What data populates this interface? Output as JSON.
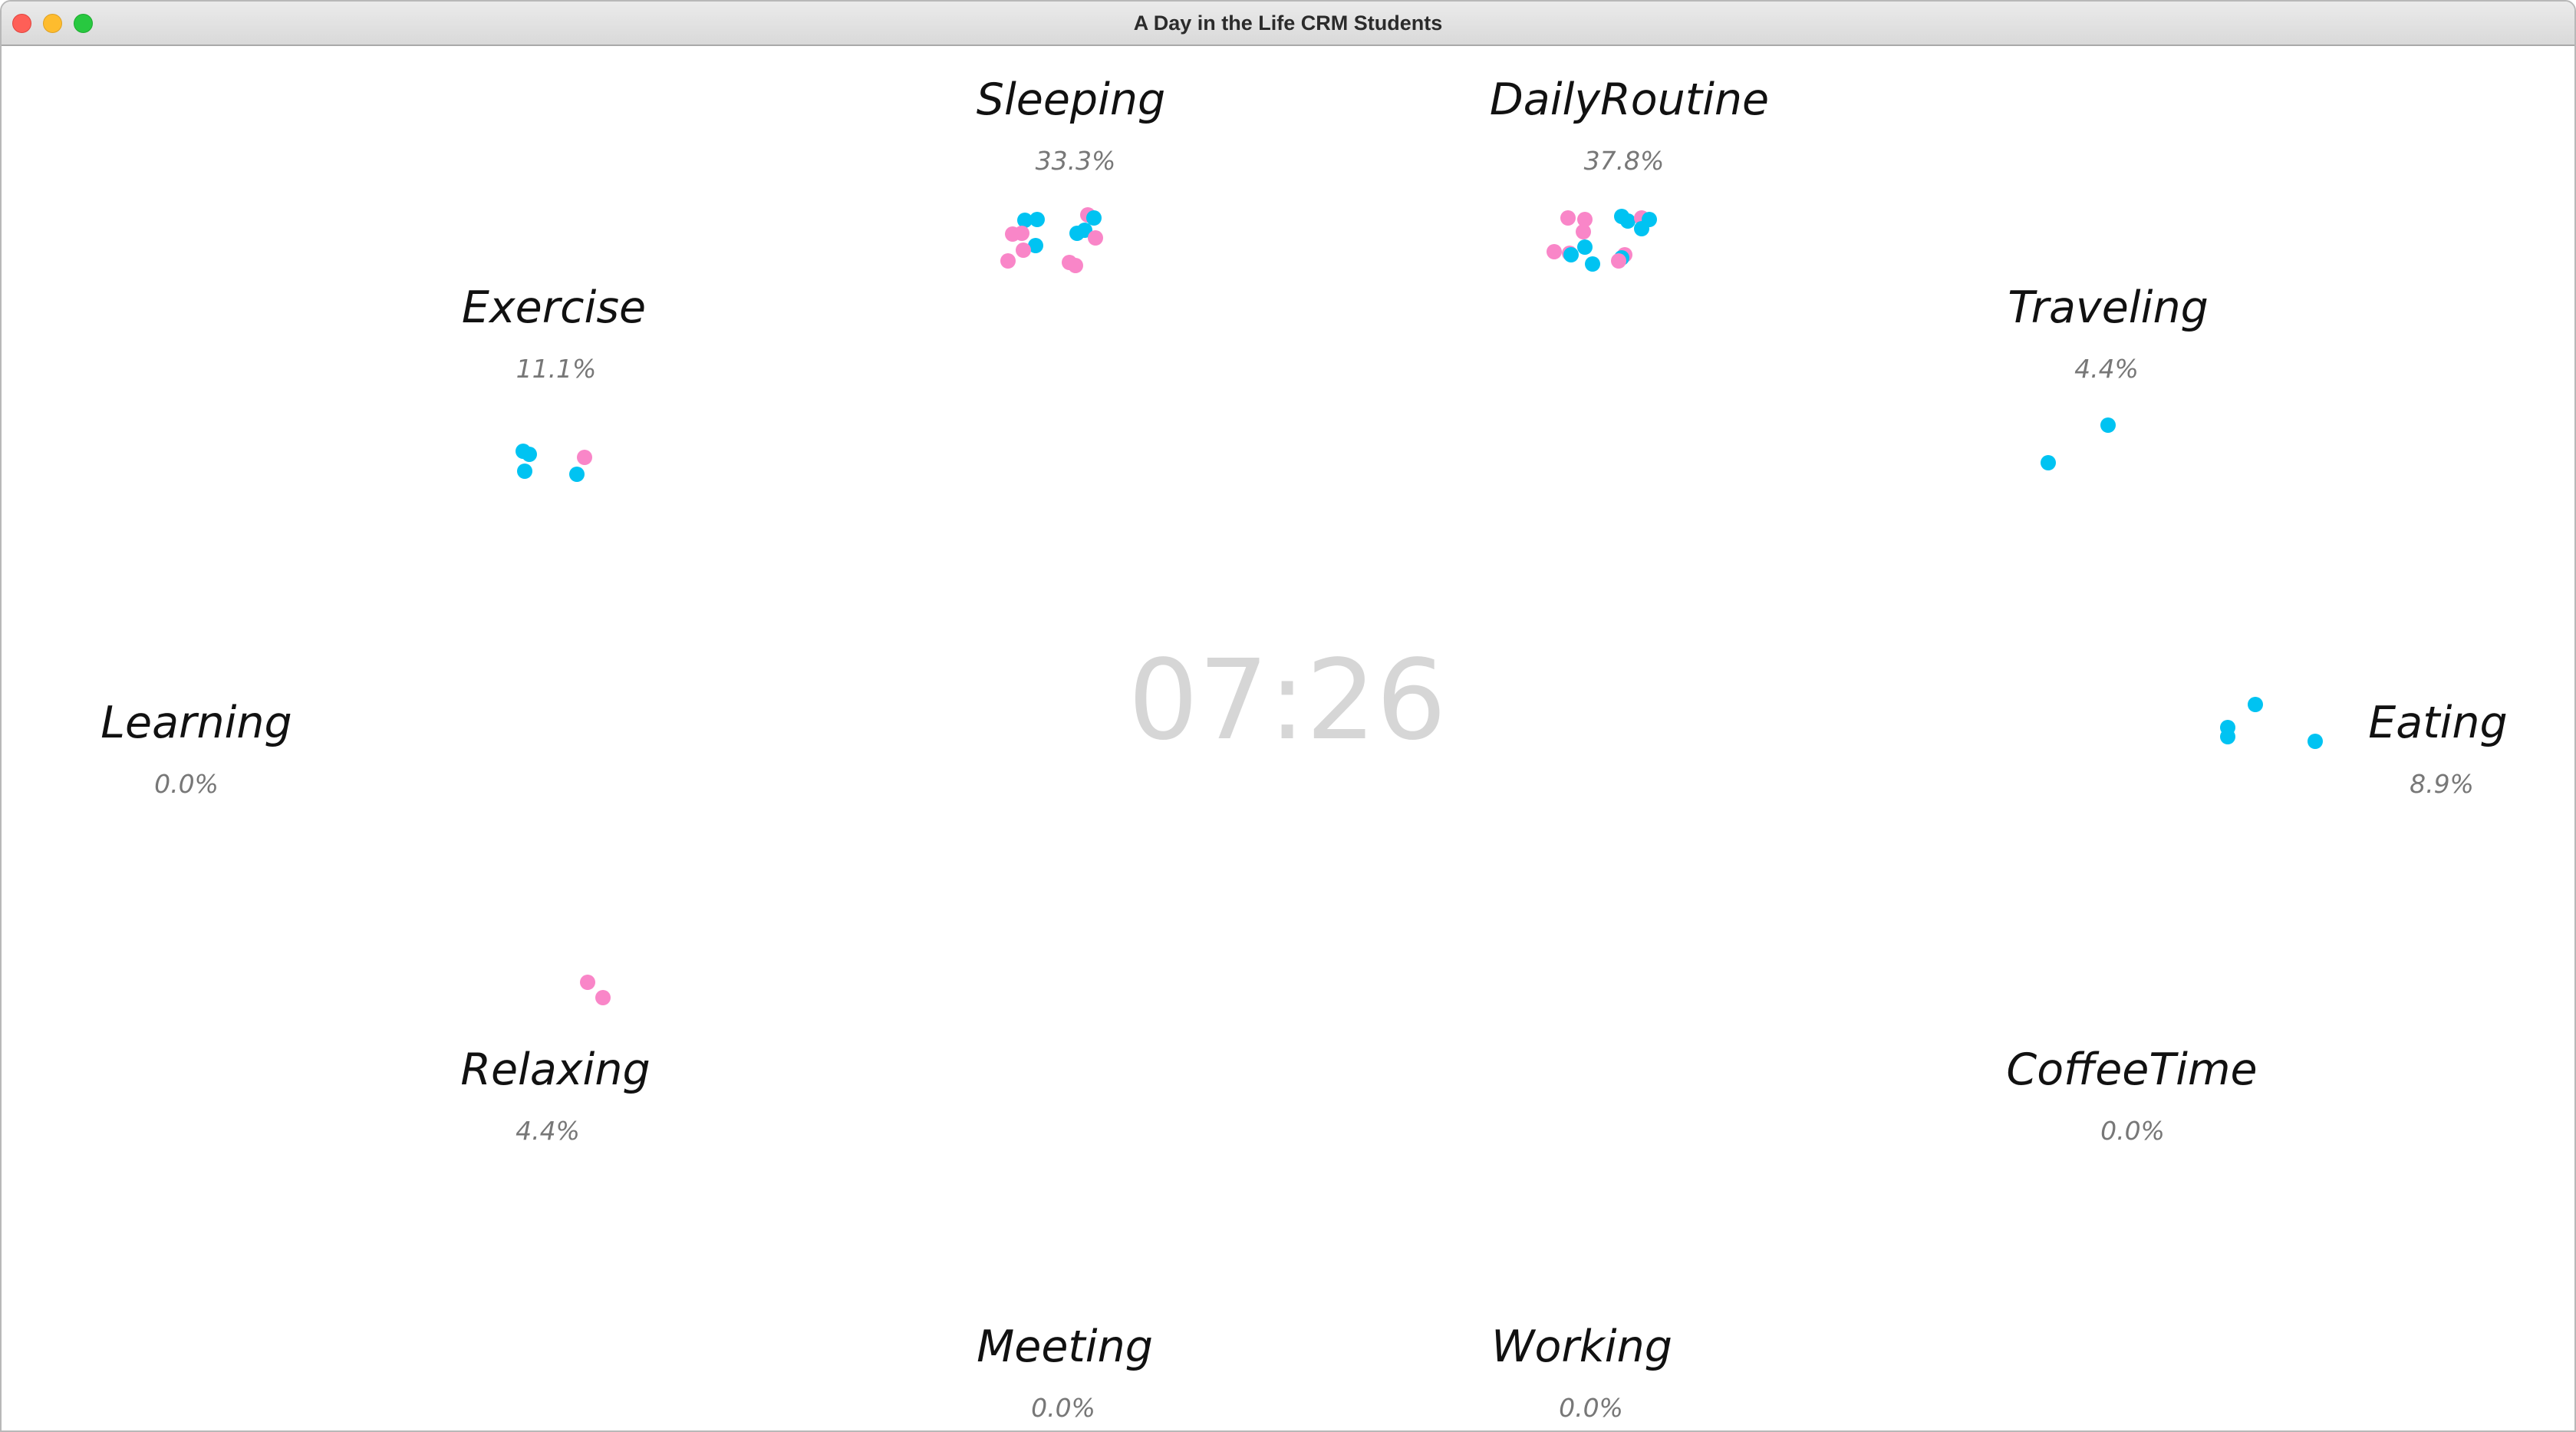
{
  "window": {
    "title": "A Day in the Life CRM Students"
  },
  "clock": "07:26",
  "colors": {
    "group_a": "#00c3f2",
    "group_b": "#f986c8",
    "label": "#111111",
    "percent": "#777777",
    "clock": "#d6d6d6"
  },
  "categories": [
    {
      "name": "Sleeping",
      "percent": "33.3%"
    },
    {
      "name": "DailyRoutine",
      "percent": "37.8%"
    },
    {
      "name": "Exercise",
      "percent": "11.1%"
    },
    {
      "name": "Traveling",
      "percent": "4.4%"
    },
    {
      "name": "Learning",
      "percent": "0.0%"
    },
    {
      "name": "Eating",
      "percent": "8.9%"
    },
    {
      "name": "Relaxing",
      "percent": "4.4%"
    },
    {
      "name": "CoffeeTime",
      "percent": "0.0%"
    },
    {
      "name": "Meeting",
      "percent": "0.0%"
    },
    {
      "name": "Working",
      "percent": "0.0%"
    }
  ]
}
